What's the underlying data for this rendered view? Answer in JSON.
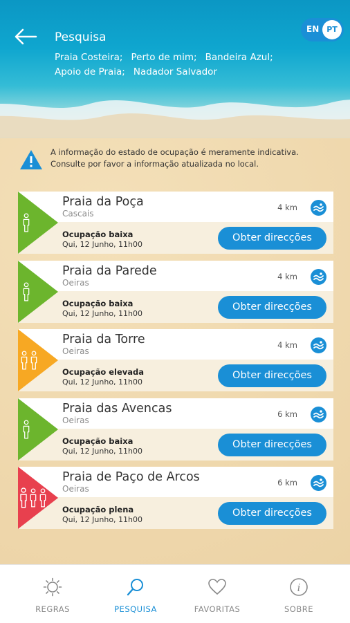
{
  "header": {
    "title": "Pesquisa",
    "filters": [
      "Praia Costeira;",
      "Perto de mim;",
      "Bandeira Azul;",
      "Apoio de Praia;",
      "Nadador Salvador"
    ],
    "lang_en": "EN",
    "lang_pt": "PT"
  },
  "notice": {
    "line1": "A informação do estado de ocupação é meramente indicativa.",
    "line2": "Consulte por favor a informação atualizada no local."
  },
  "colors": {
    "low": "#6cb52d",
    "high": "#f7a823",
    "full": "#e8404e",
    "accent": "#1a8fd6"
  },
  "beaches": [
    {
      "name": "Praia da Poça",
      "town": "Cascais",
      "distance": "4 km",
      "occupancy": "Ocupação baixa",
      "date": "Qui, 12 Junho, 11h00",
      "level": "low",
      "button": "Obter direcções"
    },
    {
      "name": "Praia da Parede",
      "town": "Oeiras",
      "distance": "4 km",
      "occupancy": "Ocupação baixa",
      "date": "Qui, 12 Junho, 11h00",
      "level": "low",
      "button": "Obter direcções"
    },
    {
      "name": "Praia da Torre",
      "town": "Oeiras",
      "distance": "4 km",
      "occupancy": "Ocupação elevada",
      "date": "Qui, 12 Junho, 11h00",
      "level": "high",
      "button": "Obter direcções"
    },
    {
      "name": "Praia das Avencas",
      "town": "Oeiras",
      "distance": "6 km",
      "occupancy": "Ocupação baixa",
      "date": "Qui, 12 Junho, 11h00",
      "level": "low",
      "button": "Obter direcções"
    },
    {
      "name": "Praia de Paço de Arcos",
      "town": "Oeiras",
      "distance": "6 km",
      "occupancy": "Ocupação plena",
      "date": "Qui, 12 Junho, 11h00",
      "level": "full",
      "button": "Obter direcções"
    }
  ],
  "nav": {
    "items": [
      {
        "label": "REGRAS",
        "icon": "sun-icon"
      },
      {
        "label": "PESQUISA",
        "icon": "search-icon"
      },
      {
        "label": "FAVORITAS",
        "icon": "heart-icon"
      },
      {
        "label": "SOBRE",
        "icon": "info-icon"
      }
    ]
  }
}
